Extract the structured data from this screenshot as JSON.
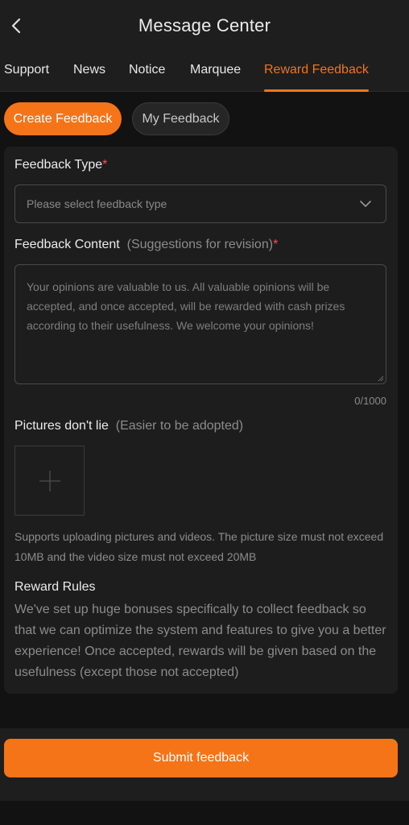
{
  "header": {
    "title": "Message Center",
    "back_icon": "chevron-left-icon"
  },
  "tabs": [
    {
      "label": "Support",
      "active": false
    },
    {
      "label": "News",
      "active": false
    },
    {
      "label": "Notice",
      "active": false
    },
    {
      "label": "Marquee",
      "active": false
    },
    {
      "label": "Reward Feedback",
      "active": true
    }
  ],
  "subtabs": {
    "create": "Create Feedback",
    "mine": "My Feedback"
  },
  "form": {
    "type_label": "Feedback Type",
    "required_mark": "*",
    "type_placeholder": "Please select feedback type",
    "content_label": "Feedback Content",
    "content_hint": "(Suggestions for revision)",
    "content_placeholder": "Your opinions are valuable to us. All valuable opinions will be accepted, and once accepted, will be rewarded with cash prizes according to their usefulness. We welcome your opinions!",
    "counter": "0/1000",
    "pictures_label": "Pictures don't lie",
    "pictures_hint": "(Easier to be adopted)",
    "upload_note": "Supports uploading pictures and videos. The picture size must not exceed 10MB and the video size must not exceed 20MB",
    "rules_title": "Reward Rules",
    "rules_body": "We've set up huge bonuses specifically to collect feedback so that we can optimize the system and features to give you a better experience! Once accepted, rewards will be given based on the usefulness (except those not accepted)"
  },
  "submit_label": "Submit feedback",
  "colors": {
    "accent": "#f57418",
    "background": "#121212",
    "surface": "#1d1d1d",
    "required": "#ff4d4f"
  }
}
